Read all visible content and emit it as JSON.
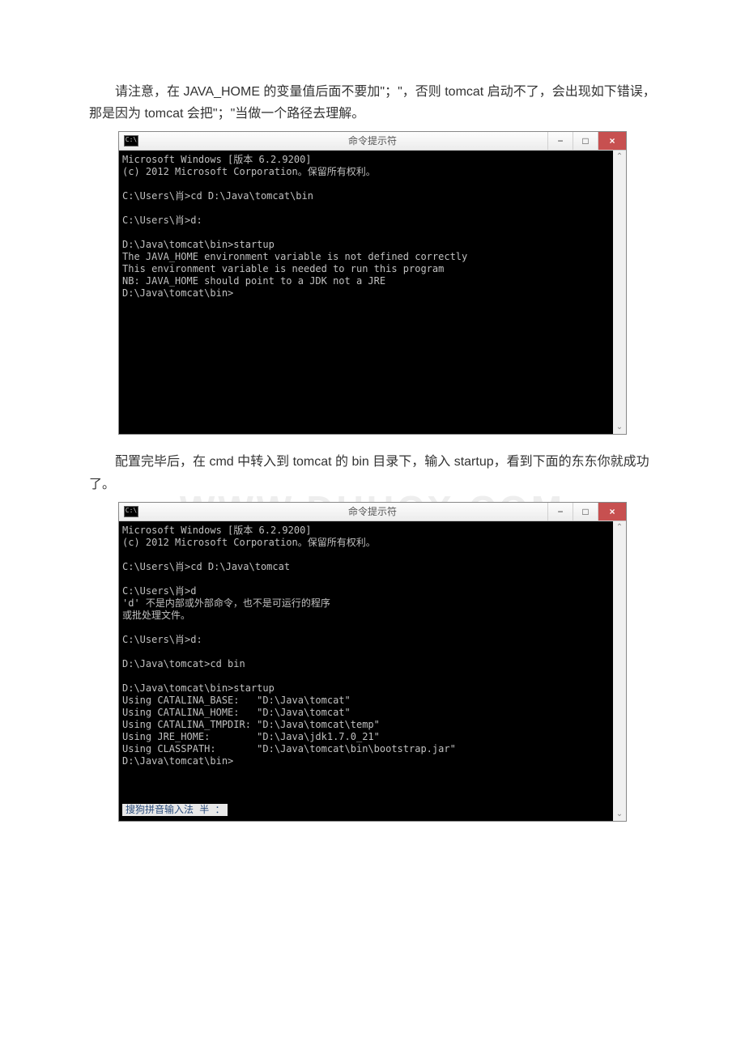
{
  "watermark": "WWW.DUUCX.COM",
  "paragraph1": "请注意，在 JAVA_HOME 的变量值后面不要加\"；\"，否则 tomcat 启动不了，会出现如下错误，那是因为 tomcat 会把\"；\"当做一个路径去理解。",
  "paragraph2": "配置完毕后，在 cmd 中转入到 tomcat 的 bin 目录下，输入 startup，看到下面的东东你就成功了。",
  "window1": {
    "title": "命令提示符",
    "icon_label": "C:\\",
    "minimize": "−",
    "maximize": "□",
    "close": "×",
    "scroll_up": "⌃",
    "scroll_down": "⌄",
    "lines": [
      "Microsoft Windows [版本 6.2.9200]",
      "(c) 2012 Microsoft Corporation。保留所有权利。",
      "",
      "C:\\Users\\肖>cd D:\\Java\\tomcat\\bin",
      "",
      "C:\\Users\\肖>d:",
      "",
      "D:\\Java\\tomcat\\bin>startup",
      "The JAVA_HOME environment variable is not defined correctly",
      "This environment variable is needed to run this program",
      "NB: JAVA_HOME should point to a JDK not a JRE",
      "D:\\Java\\tomcat\\bin>"
    ]
  },
  "window2": {
    "title": "命令提示符",
    "icon_label": "C:\\",
    "minimize": "−",
    "maximize": "□",
    "close": "×",
    "scroll_up": "⌃",
    "scroll_down": "⌄",
    "lines_a": [
      "Microsoft Windows [版本 6.2.9200]",
      "(c) 2012 Microsoft Corporation。保留所有权利。",
      "",
      "C:\\Users\\肖>cd D:\\Java\\tomcat",
      "",
      "C:\\Users\\肖>d",
      "'d' 不是内部或外部命令，也不是可运行的程序",
      "或批处理文件。",
      "",
      "C:\\Users\\肖>d:",
      "",
      "D:\\Java\\tomcat>cd bin",
      "",
      "D:\\Java\\tomcat\\bin>startup",
      "Using CATALINA_BASE:   \"D:\\Java\\tomcat\"",
      "Using CATALINA_HOME:   \"D:\\Java\\tomcat\"",
      "Using CATALINA_TMPDIR: \"D:\\Java\\tomcat\\temp\"",
      "Using JRE_HOME:        \"D:\\Java\\jdk1.7.0_21\"",
      "Using CLASSPATH:       \"D:\\Java\\tomcat\\bin\\bootstrap.jar\"",
      "D:\\Java\\tomcat\\bin>"
    ],
    "ime": "搜狗拼音输入法 半 ："
  }
}
